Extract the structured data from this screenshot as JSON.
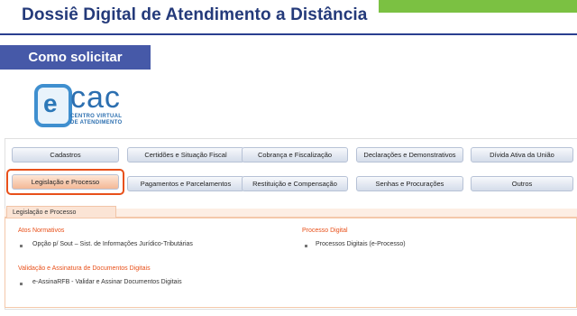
{
  "header": {
    "title": "Dossiê Digital de Atendimento a Distância"
  },
  "section_badge": "Como solicitar",
  "logo": {
    "letter": "e",
    "name": "cac",
    "subtitle_line1": "CENTRO VIRTUAL",
    "subtitle_line2": "DE ATENDIMENTO"
  },
  "menu": {
    "row1": [
      "Cadastros",
      "Certidões e Situação Fiscal",
      "Cobrança e Fiscalização",
      "Declarações e Demonstrativos",
      "Dívida Ativa da União"
    ],
    "row2": [
      "Legislação e Processo",
      "Pagamentos e Parcelamentos",
      "Restituição e Compensação",
      "Senhas e Procurações",
      "Outros"
    ]
  },
  "active_tab": "Legislação e Processo",
  "content": {
    "atos": {
      "heading": "Atos Normativos",
      "items": [
        "Opção p/ Sout – Sist. de Informações Jurídico-Tributárias"
      ]
    },
    "processo": {
      "heading": "Processo Digital",
      "items": [
        "Processos Digitais (e-Processo)"
      ]
    },
    "validacao": {
      "heading": "Validação e Assinatura de Documentos Digitais",
      "items": [
        "e-AssinaRFB - Validar e Assinar Documentos Digitais"
      ]
    }
  },
  "colors": {
    "title": "#243a7a",
    "accent_orange": "#e8501a",
    "badge_blue": "#4659a8",
    "green": "#7bc142"
  }
}
